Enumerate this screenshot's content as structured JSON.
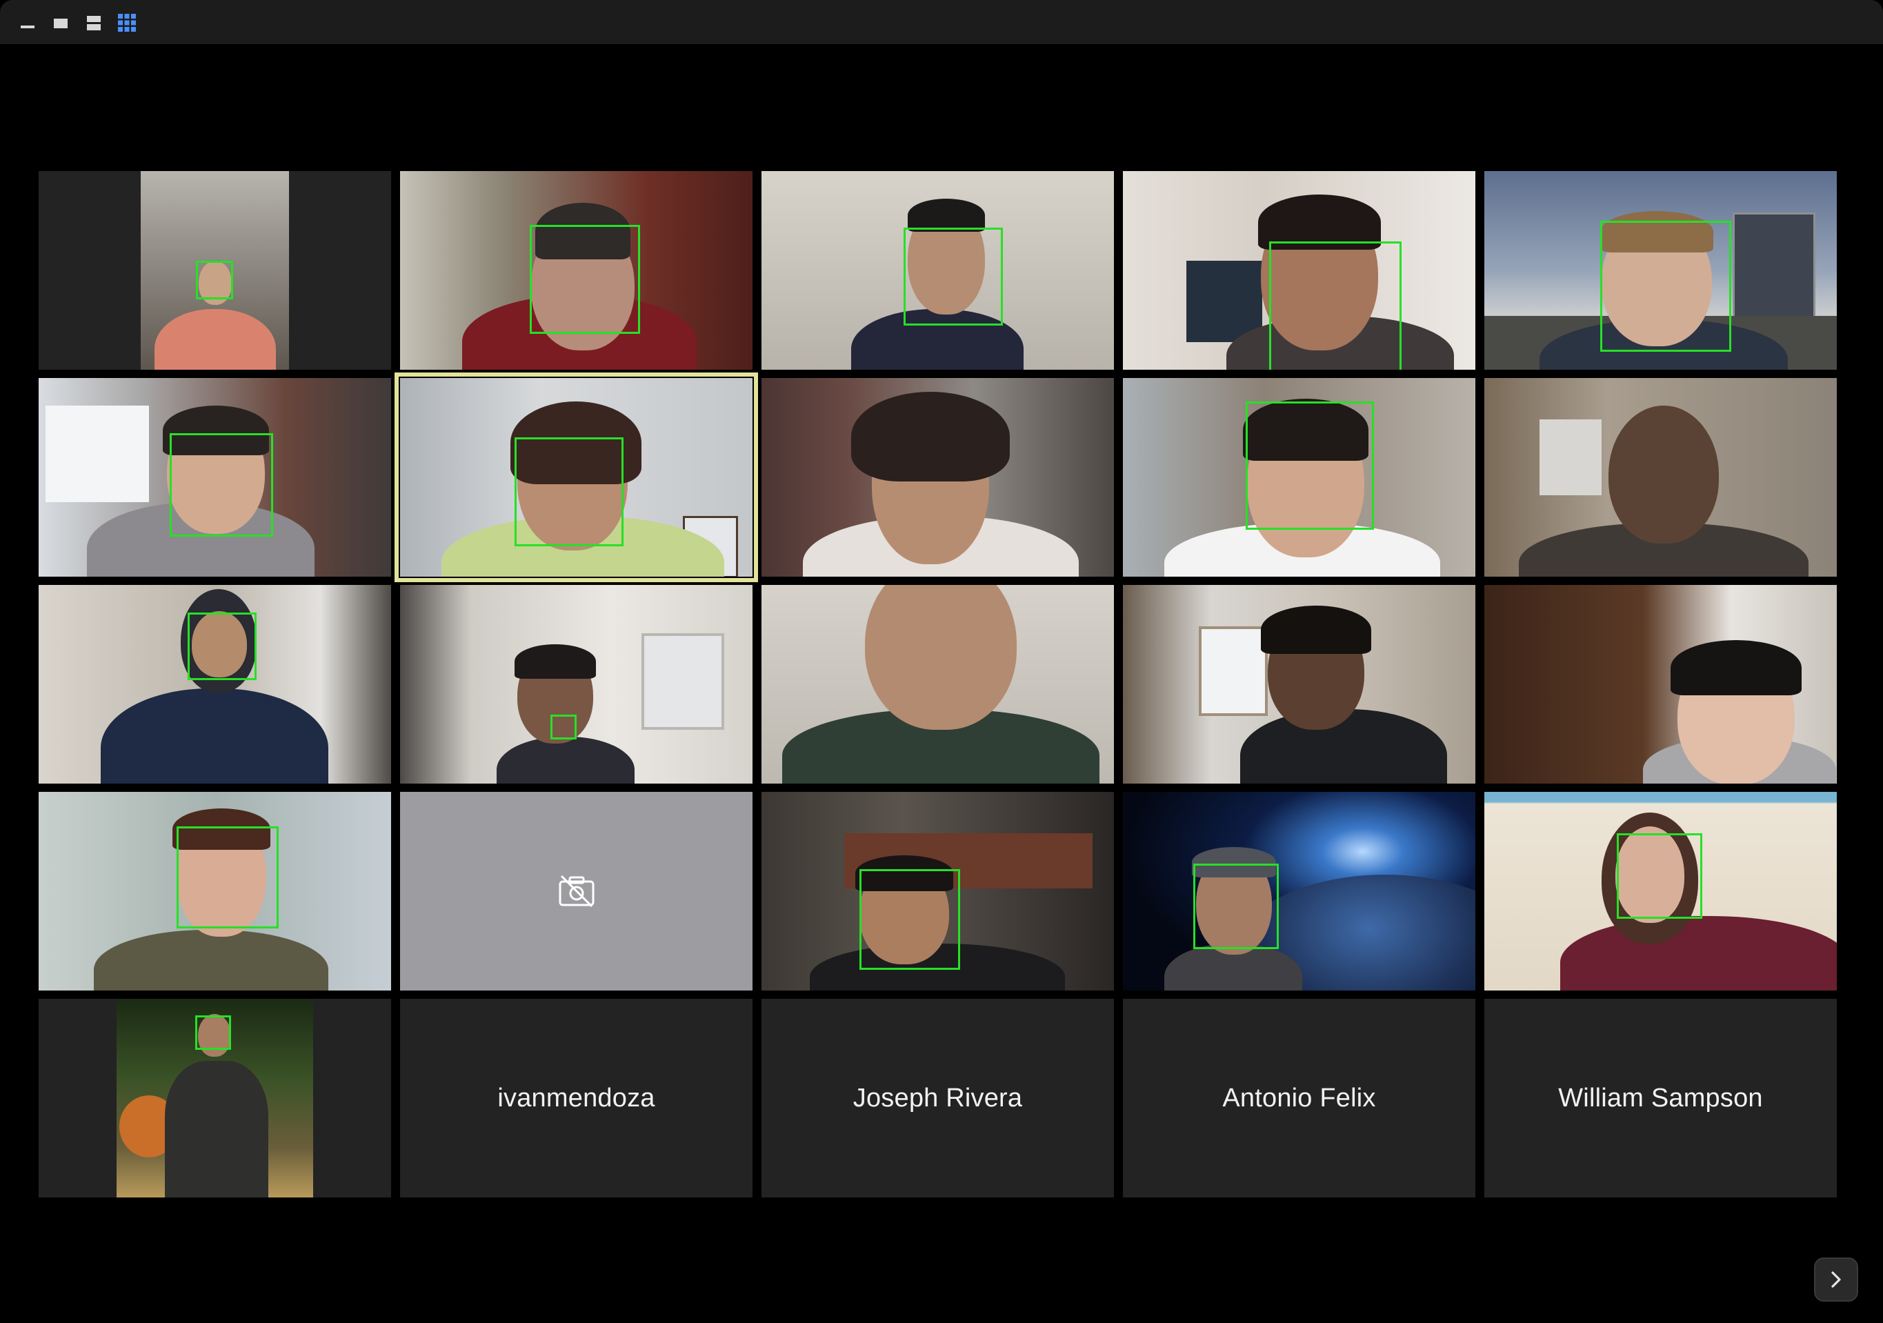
{
  "window": {
    "view_controls": [
      {
        "icon": "minimize-bar-icon",
        "active": false
      },
      {
        "icon": "speaker-view-icon",
        "active": false
      },
      {
        "icon": "strip-view-icon",
        "active": false
      },
      {
        "icon": "gallery-view-icon",
        "active": true
      }
    ]
  },
  "gallery": {
    "participants": [
      {
        "label": "",
        "video": true,
        "bg": "#3d3b37"
      },
      {
        "label": "",
        "video": true,
        "bg": "#6e2f26"
      },
      {
        "label": "",
        "video": true,
        "bg": "#c9c5bd"
      },
      {
        "label": "",
        "video": true,
        "bg": "#dcd6d0"
      },
      {
        "label": "",
        "video": true,
        "bg": "#6f7f98"
      },
      {
        "label": "",
        "video": true,
        "bg": "#8f9095"
      },
      {
        "label": "",
        "video": true,
        "bg": "#b9bdc2",
        "active_speaker": true
      },
      {
        "label": "",
        "video": true,
        "bg": "#5a4a46"
      },
      {
        "label": "",
        "video": true,
        "bg": "#9aa0a4"
      },
      {
        "label": "",
        "video": true,
        "bg": "#6b5d4d"
      },
      {
        "label": "",
        "video": true,
        "bg": "#9a968f"
      },
      {
        "label": "",
        "video": true,
        "bg": "#d2cec6"
      },
      {
        "label": "",
        "video": true,
        "bg": "#bfbab0"
      },
      {
        "label": "",
        "video": true,
        "bg": "#a79f92"
      },
      {
        "label": "",
        "video": true,
        "bg": "#4a3024"
      },
      {
        "label": "",
        "video": true,
        "bg": "#8d9494"
      },
      {
        "label": "",
        "video": false,
        "bg": "#9d9ca1"
      },
      {
        "label": "",
        "video": true,
        "bg": "#3b3530"
      },
      {
        "label": "",
        "video": true,
        "bg": "#0b1630"
      },
      {
        "label": "",
        "video": true,
        "bg": "#ece3d3"
      },
      {
        "label": "",
        "video": true,
        "bg": "#2d3a22"
      },
      {
        "label": "ivanmendoza",
        "video": false
      },
      {
        "label": "Joseph Rivera",
        "video": false
      },
      {
        "label": "Antonio Felix",
        "video": false
      },
      {
        "label": "William Sampson",
        "video": false
      }
    ]
  },
  "navigation": {
    "next_page_icon": "chevron-right-icon"
  }
}
